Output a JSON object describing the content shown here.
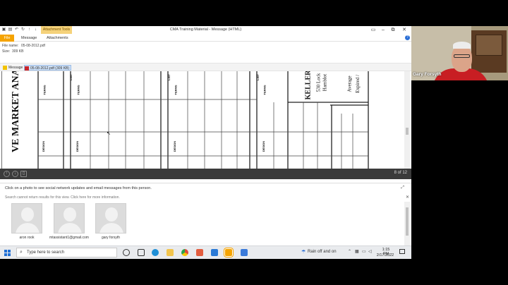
{
  "window": {
    "title": "CMA Training Material  -  Message (HTML)",
    "context_tab": "Attachment Tools",
    "controls": {
      "minimize": "–",
      "restore": "▫",
      "maximize": "⧉",
      "close": "✕"
    },
    "qat_icons": [
      "save-icon",
      "undo-icon",
      "redo-icon",
      "up-arrow-icon",
      "down-arrow-icon",
      "customize-icon"
    ]
  },
  "ribbon": {
    "tabs": [
      "File",
      "Message",
      "Attachments"
    ],
    "help": "?"
  },
  "file_info": {
    "name_label": "File name:",
    "name_value": "05-08-2012.pdf",
    "size_label": "Size:",
    "size_value": "309 KB"
  },
  "attachments": {
    "message_label": "Message",
    "pdf_label": "05-08-2012.pdf (309 KB)"
  },
  "preview": {
    "page_counter": "8 of 12",
    "side_text": "VE MARKET ANA",
    "header_right": "KELLER",
    "address_line": "530 Lock",
    "address_line2": "Hamblot",
    "avg_line": "Average",
    "expired_line": "Expired /",
    "col_labels": [
      "LIST",
      "TERMS",
      "DESIGN"
    ]
  },
  "people_pane": {
    "header": "Click on a photo to see social network updates and email messages from this person.",
    "note": "Search cannot return results for this view. Click here for more information.",
    "people": [
      {
        "name": "aron rook"
      },
      {
        "name": "mtassistant1@gmail.com"
      },
      {
        "name": "gary forsyth"
      }
    ]
  },
  "taskbar": {
    "search_placeholder": "Type here to search",
    "weather": "Rain off and on",
    "time": "1:15 PM",
    "date": "2/17/2022"
  },
  "webcam": {
    "name": "Gary Forsyth"
  },
  "colors": {
    "file_tab": "#f5a300",
    "context_tab": "#f5d27a",
    "toolbar": "#3b3b3b",
    "taskbar": "#e9ebee"
  }
}
